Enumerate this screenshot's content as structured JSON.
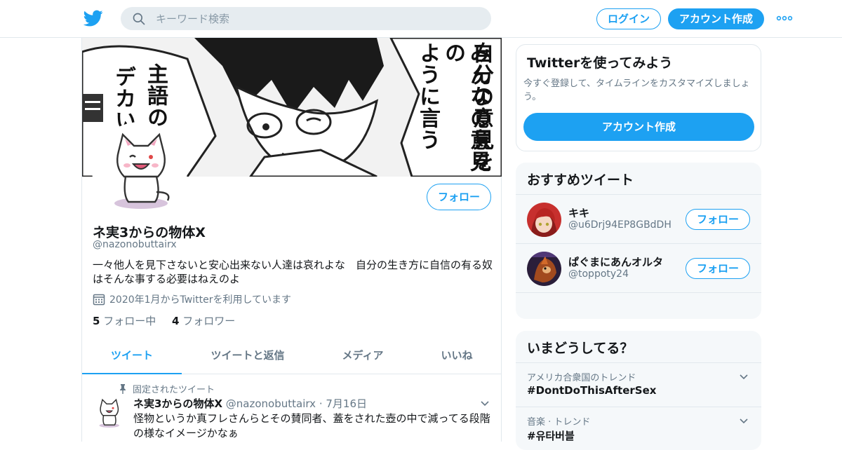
{
  "topbar": {
    "logo_icon": "twitter-bird-icon",
    "search_placeholder": "キーワード検索",
    "login_label": "ログイン",
    "signup_label": "アカウント作成",
    "more_icon": "more-dots-icon"
  },
  "colors": {
    "accent": "#1da1f2",
    "muted": "#657786",
    "text": "#14171a",
    "border": "#e1e8ed",
    "panel": "#f5f8fa"
  },
  "profile": {
    "banner_text": [
      "自分の意見を",
      "みんなの意見の",
      "ように言う",
      "主語の",
      "デカい"
    ],
    "follow_label": "フォロー",
    "display_name": "ネ実3からの物体X",
    "handle": "@nazonobuttairx",
    "bio": "一々他人を見下さないと安心出来ない人達は哀れよな　自分の生き方に自信の有る奴はそんな事する必要はねえのよ",
    "joined": "2020年1月からTwitterを利用しています",
    "following_count": "5",
    "following_label": "フォロー中",
    "followers_count": "4",
    "followers_label": "フォロワー"
  },
  "tabs": [
    "ツイート",
    "ツイートと返信",
    "メディア",
    "いいね"
  ],
  "pinned_tweet": {
    "pinned_label": "固定されたツイート",
    "name": "ネ実3からの物体X",
    "handle": "@nazonobuttairx",
    "date": "7月16日",
    "text": "怪物というか真フレさんらとその賛同者、蓋をされた壺の中で減ってる段階の様なイメージかなぁ"
  },
  "signup_card": {
    "title": "Twitterを使ってみよう",
    "desc": "今すぐ登録して、タイムラインをカスタマイズしましょう。",
    "button": "アカウント作成"
  },
  "recommend": {
    "title": "おすすめツイート",
    "users": [
      {
        "name": "キキ",
        "handle": "@u6Drj94EP8GBdDH",
        "follow": "フォロー"
      },
      {
        "name": "ぱぐまにあんオルタ",
        "handle": "@toppoty24",
        "follow": "フォロー"
      }
    ]
  },
  "trends": {
    "title": "いまどうしてる？",
    "items": [
      {
        "context": "アメリカ合衆国のトレンド",
        "tag": "#DontDoThisAfterSex"
      },
      {
        "context": "音楽 · トレンド",
        "tag": "#유타버블"
      }
    ]
  }
}
